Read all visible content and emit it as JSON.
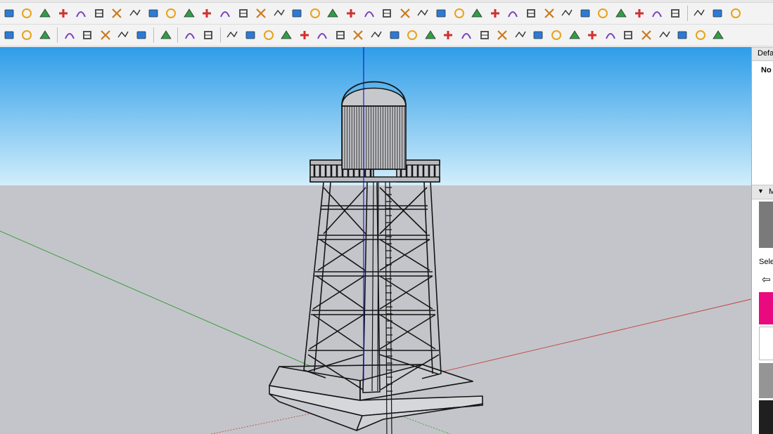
{
  "toolbar_row1": [
    "paint-bucket-icon",
    "face-blue-icon",
    "face-yellow-icon",
    "face-green-icon",
    "face-red-icon",
    "orient-faces-icon",
    "arc-orange-icon",
    "red-square-icon",
    "divide-icon",
    "flag-icon",
    "fold-icon",
    "link-icon",
    "fillet-icon",
    "red-curve-icon",
    "red-cross-icon",
    "green-cross-icon",
    "blue-cross-icon",
    "cone-green-icon",
    "cone-teal-icon",
    "cone-yellow-icon",
    "hook-icon",
    "green-loop-icon",
    "loop-icon",
    "move-arrows-icon",
    "brown-box-icon",
    "red-ring-icon",
    "cube-green-icon",
    "component-copy-icon",
    "component-red-icon",
    "red-gem-icon",
    "grid-dots-icon",
    "frame-icon",
    "orange-hatch-icon",
    "orange-grid-icon",
    "orange-tile-icon",
    "scatter-icon",
    "dashed-circle-icon",
    "grid-small-icon",
    "separator",
    "dark-box-icon",
    "terrain-icon",
    "box-outline-icon"
  ],
  "toolbar_row2": [
    "layers-stack-icon",
    "refresh-icon",
    "layer-manager-icon",
    "separator",
    "add-circle-icon",
    "tree-icon",
    "chart-icon",
    "checker-ball-icon",
    "cloud-upload-icon",
    "separator",
    "gear-icon",
    "separator",
    "mail-icon",
    "info-icon",
    "separator",
    "curve-2d-icon",
    "curve-red-icon",
    "tape-icon",
    "cut-icon",
    "bezier-icon",
    "rotate-freehand-icon",
    "hook-line-icon",
    "box3d-icon",
    "cylinder-icon",
    "curve-arrow-icon",
    "angle-icon",
    "line-angle-icon",
    "slash-line-icon",
    "slope-icon",
    "crop-box-icon",
    "triangle-icon",
    "wave-lines-icon",
    "comb-icon",
    "hand-icon",
    "curve-shape-icon",
    "arrow-left-icon",
    "slant-lines-icon",
    "arrow-right-icon",
    "double-arrow-icon",
    "fan-lines-icon",
    "box-flat-icon",
    "bend-icon",
    "arch-icon"
  ],
  "colors": {
    "sky_top": "#2e9de8",
    "sky_bottom": "#d2eefb",
    "ground": "#c4c5ca",
    "axis_blue": "#1010cc",
    "axis_red": "#c0403e",
    "axis_green": "#2e9a2e",
    "model_line": "#151515",
    "swatch_magenta": "#ea0a7f",
    "swatch_white": "#ffffff",
    "swatch_gray": "#959595",
    "swatch_dark": "#1f1f1f",
    "swatch_mid": "#7a7a7a"
  },
  "tray": {
    "default_label": "Defa",
    "no_selection": "No s",
    "materials_label": "M",
    "select_label": "Sele",
    "back_icon": "back-arrow-icon"
  }
}
